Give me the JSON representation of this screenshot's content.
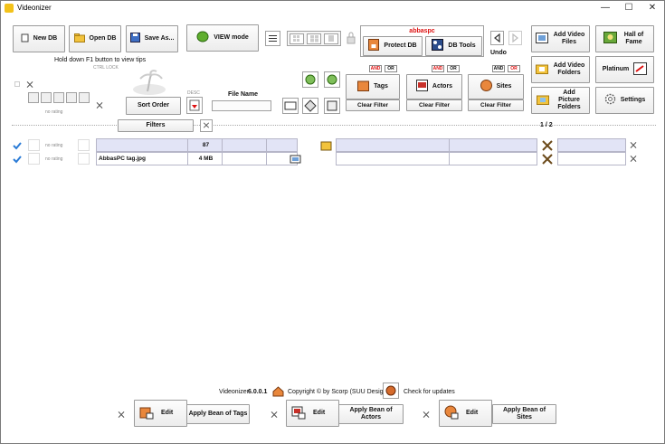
{
  "window": {
    "title": "Videonizer",
    "minimize": "—",
    "maximize": "☐",
    "close": "✕"
  },
  "toolbar": {
    "new_db": "New DB",
    "open_db": "Open DB",
    "save_as": "Save As...",
    "view_mode": "VIEW mode",
    "user": "abbaspc",
    "protect_db": "Protect DB",
    "db_tools": "DB Tools",
    "undo": "Undo",
    "add_video_files": "Add Video Files",
    "hall_of_fame": "Hall of Fame",
    "add_video_folders": "Add Video Folders",
    "platinum": "Platinum",
    "add_picture_folders": "Add Picture Folders",
    "settings": "Settings"
  },
  "hints": {
    "f1_tip": "Hold down F1 button to view tips",
    "ctrl_lock": "CTRL LOCK",
    "no_rating": "no rating"
  },
  "sort": {
    "label": "Sort Order",
    "desc": "DESC",
    "file_name_label": "File Name",
    "file_name_value": ""
  },
  "filters": {
    "button": "Filters",
    "page": "1 / 2",
    "and": "AND",
    "or": "OR",
    "groups": [
      {
        "name": "Tags",
        "clear": "Clear Filter"
      },
      {
        "name": "Actors",
        "clear": "Clear Filter"
      },
      {
        "name": "Sites",
        "clear": "Clear Filter"
      }
    ]
  },
  "rows": [
    {
      "rating": "no rating",
      "name": "",
      "size": "87",
      "selected": true
    },
    {
      "rating": "no rating",
      "name": "AbbasPC tag.jpg",
      "size": "4 MB",
      "selected": false
    }
  ],
  "footer": {
    "app": "Videonizer",
    "version": "6.0.0.1",
    "copyright": "Copyright © by Scorp (SUU Design)",
    "updates": "Check for updates",
    "edit": "Edit",
    "apply_tags": "Apply Bean of Tags",
    "apply_actors": "Apply Bean of Actors",
    "apply_sites": "Apply Bean of Sites"
  },
  "colors": {
    "accent": "#f3c21a",
    "selection": "#e2e4f6",
    "red": "#dd1111",
    "check": "#2a7bd6"
  }
}
